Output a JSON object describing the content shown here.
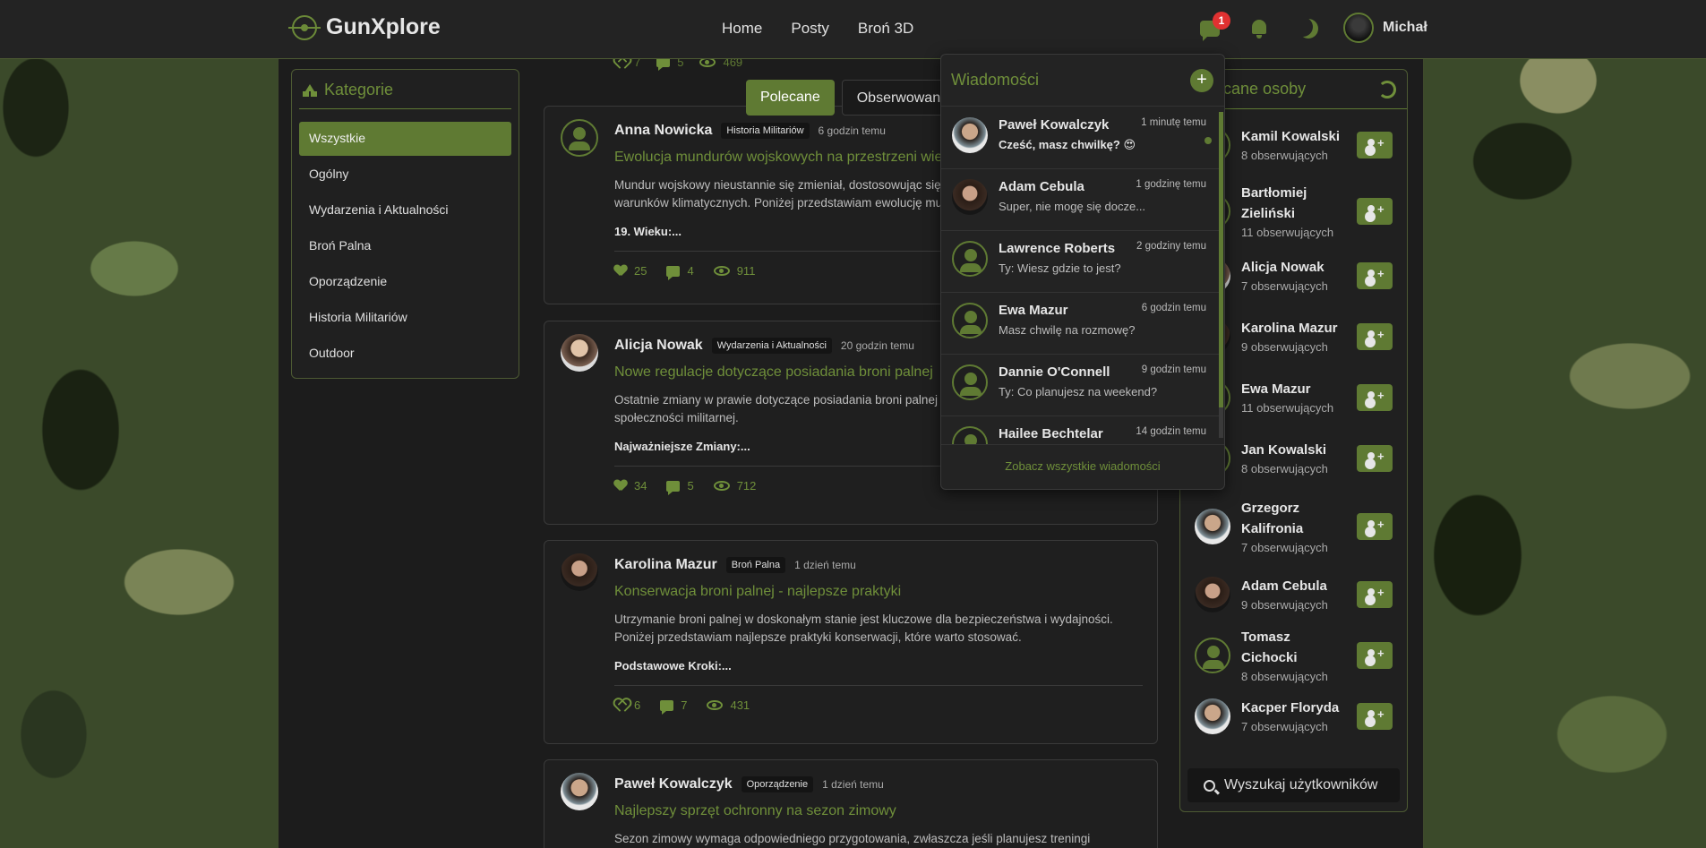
{
  "navbar": {
    "brand": "GunXplore",
    "links": [
      "Home",
      "Posty",
      "Broń 3D"
    ],
    "messages_badge": "1",
    "user_name": "Michał"
  },
  "categories": {
    "title": "Kategorie",
    "items": [
      "Wszystkie",
      "Ogólny",
      "Wydarzenia i Aktualności",
      "Broń Palna",
      "Oporządzenie",
      "Historia Militariów",
      "Outdoor"
    ],
    "active": "Wszystkie"
  },
  "feed": {
    "tabs": [
      "Polecane",
      "Obserwowani"
    ],
    "top_stats": {
      "likes": "7",
      "comments": "5",
      "views": "469"
    },
    "posts": [
      {
        "author": "Anna Nowicka",
        "category": "Historia Militariów",
        "time": "6 godzin temu",
        "title": "Ewolucja mundurów wojskowych na przestrzeni wieków",
        "body": "Mundur wojskowy nieustannie się zmieniał, dostosowując się do nowych technologii i\nwarunków klimatycznych. Poniżej przedstawiam ewolucję mundurów",
        "subtitle": "19. Wieku:...",
        "likes": "25",
        "comments": "4",
        "views": "911"
      },
      {
        "author": "Alicja Nowak",
        "category": "Wydarzenia i Aktualności",
        "time": "20 godzin temu",
        "title": "Nowe regulacje dotyczące posiadania broni palnej",
        "body": "Ostatnie zmiany w prawie dotyczące posiadania broni palnej\nspołeczności militarnej.",
        "subtitle": "Najważniejsze Zmiany:...",
        "likes": "34",
        "comments": "5",
        "views": "712"
      },
      {
        "author": "Karolina Mazur",
        "category": "Broń Palna",
        "time": "1 dzień temu",
        "title": "Konserwacja broni palnej - najlepsze praktyki",
        "body": "Utrzymanie broni palnej w doskonałym stanie jest kluczowe dla bezpieczeństwa i wydajności.\nPoniżej przedstawiam najlepsze praktyki konserwacji, które warto stosować.",
        "subtitle": "Podstawowe Kroki:...",
        "likes": "6",
        "comments": "7",
        "views": "431"
      },
      {
        "author": "Paweł Kowalczyk",
        "category": "Oporządzenie",
        "time": "1 dzień temu",
        "title": "Najlepszy sprzęt ochronny na sezon zimowy",
        "body": "Sezon zimowy wymaga odpowiedniego przygotowania, zwłaszcza jeśli planujesz treningi"
      }
    ]
  },
  "recommended": {
    "title": "Polecane osoby",
    "people": [
      {
        "name": "Kamil Kowalski",
        "followers": "8 obserwujących"
      },
      {
        "name": "Bartłomiej Zieliński",
        "followers": "11 obserwujących"
      },
      {
        "name": "Alicja Nowak",
        "followers": "7 obserwujących"
      },
      {
        "name": "Karolina Mazur",
        "followers": "9 obserwujących"
      },
      {
        "name": "Ewa Mazur",
        "followers": "11 obserwujących"
      },
      {
        "name": "Jan Kowalski",
        "followers": "8 obserwujących"
      },
      {
        "name": "Grzegorz Kalifronia",
        "followers": "7 obserwujących"
      },
      {
        "name": "Adam Cebula",
        "followers": "9 obserwujących"
      },
      {
        "name": "Tomasz Cichocki",
        "followers": "8 obserwujących"
      },
      {
        "name": "Kacper Floryda",
        "followers": "7 obserwujących"
      }
    ],
    "search_label": "Wyszukaj użytkowników"
  },
  "messages": {
    "title": "Wiadomości",
    "items": [
      {
        "name": "Paweł Kowalczyk",
        "time": "1 minutę temu",
        "text": "Cześć, masz chwilkę? 😍",
        "unread": true
      },
      {
        "name": "Adam Cebula",
        "time": "1 godzinę temu",
        "text": "Super, nie mogę się docze..."
      },
      {
        "name": "Lawrence Roberts",
        "time": "2 godziny temu",
        "text": "Ty: Wiesz gdzie to jest?"
      },
      {
        "name": "Ewa Mazur",
        "time": "6 godzin temu",
        "text": "Masz chwilę na rozmowę?"
      },
      {
        "name": "Dannie O'Connell",
        "time": "9 godzin temu",
        "text": "Ty: Co planujesz na weekend?"
      },
      {
        "name": "Hailee Bechtelar",
        "time": "14 godzin temu",
        "text": ""
      }
    ],
    "footer": "Zobacz wszystkie wiadomości"
  }
}
